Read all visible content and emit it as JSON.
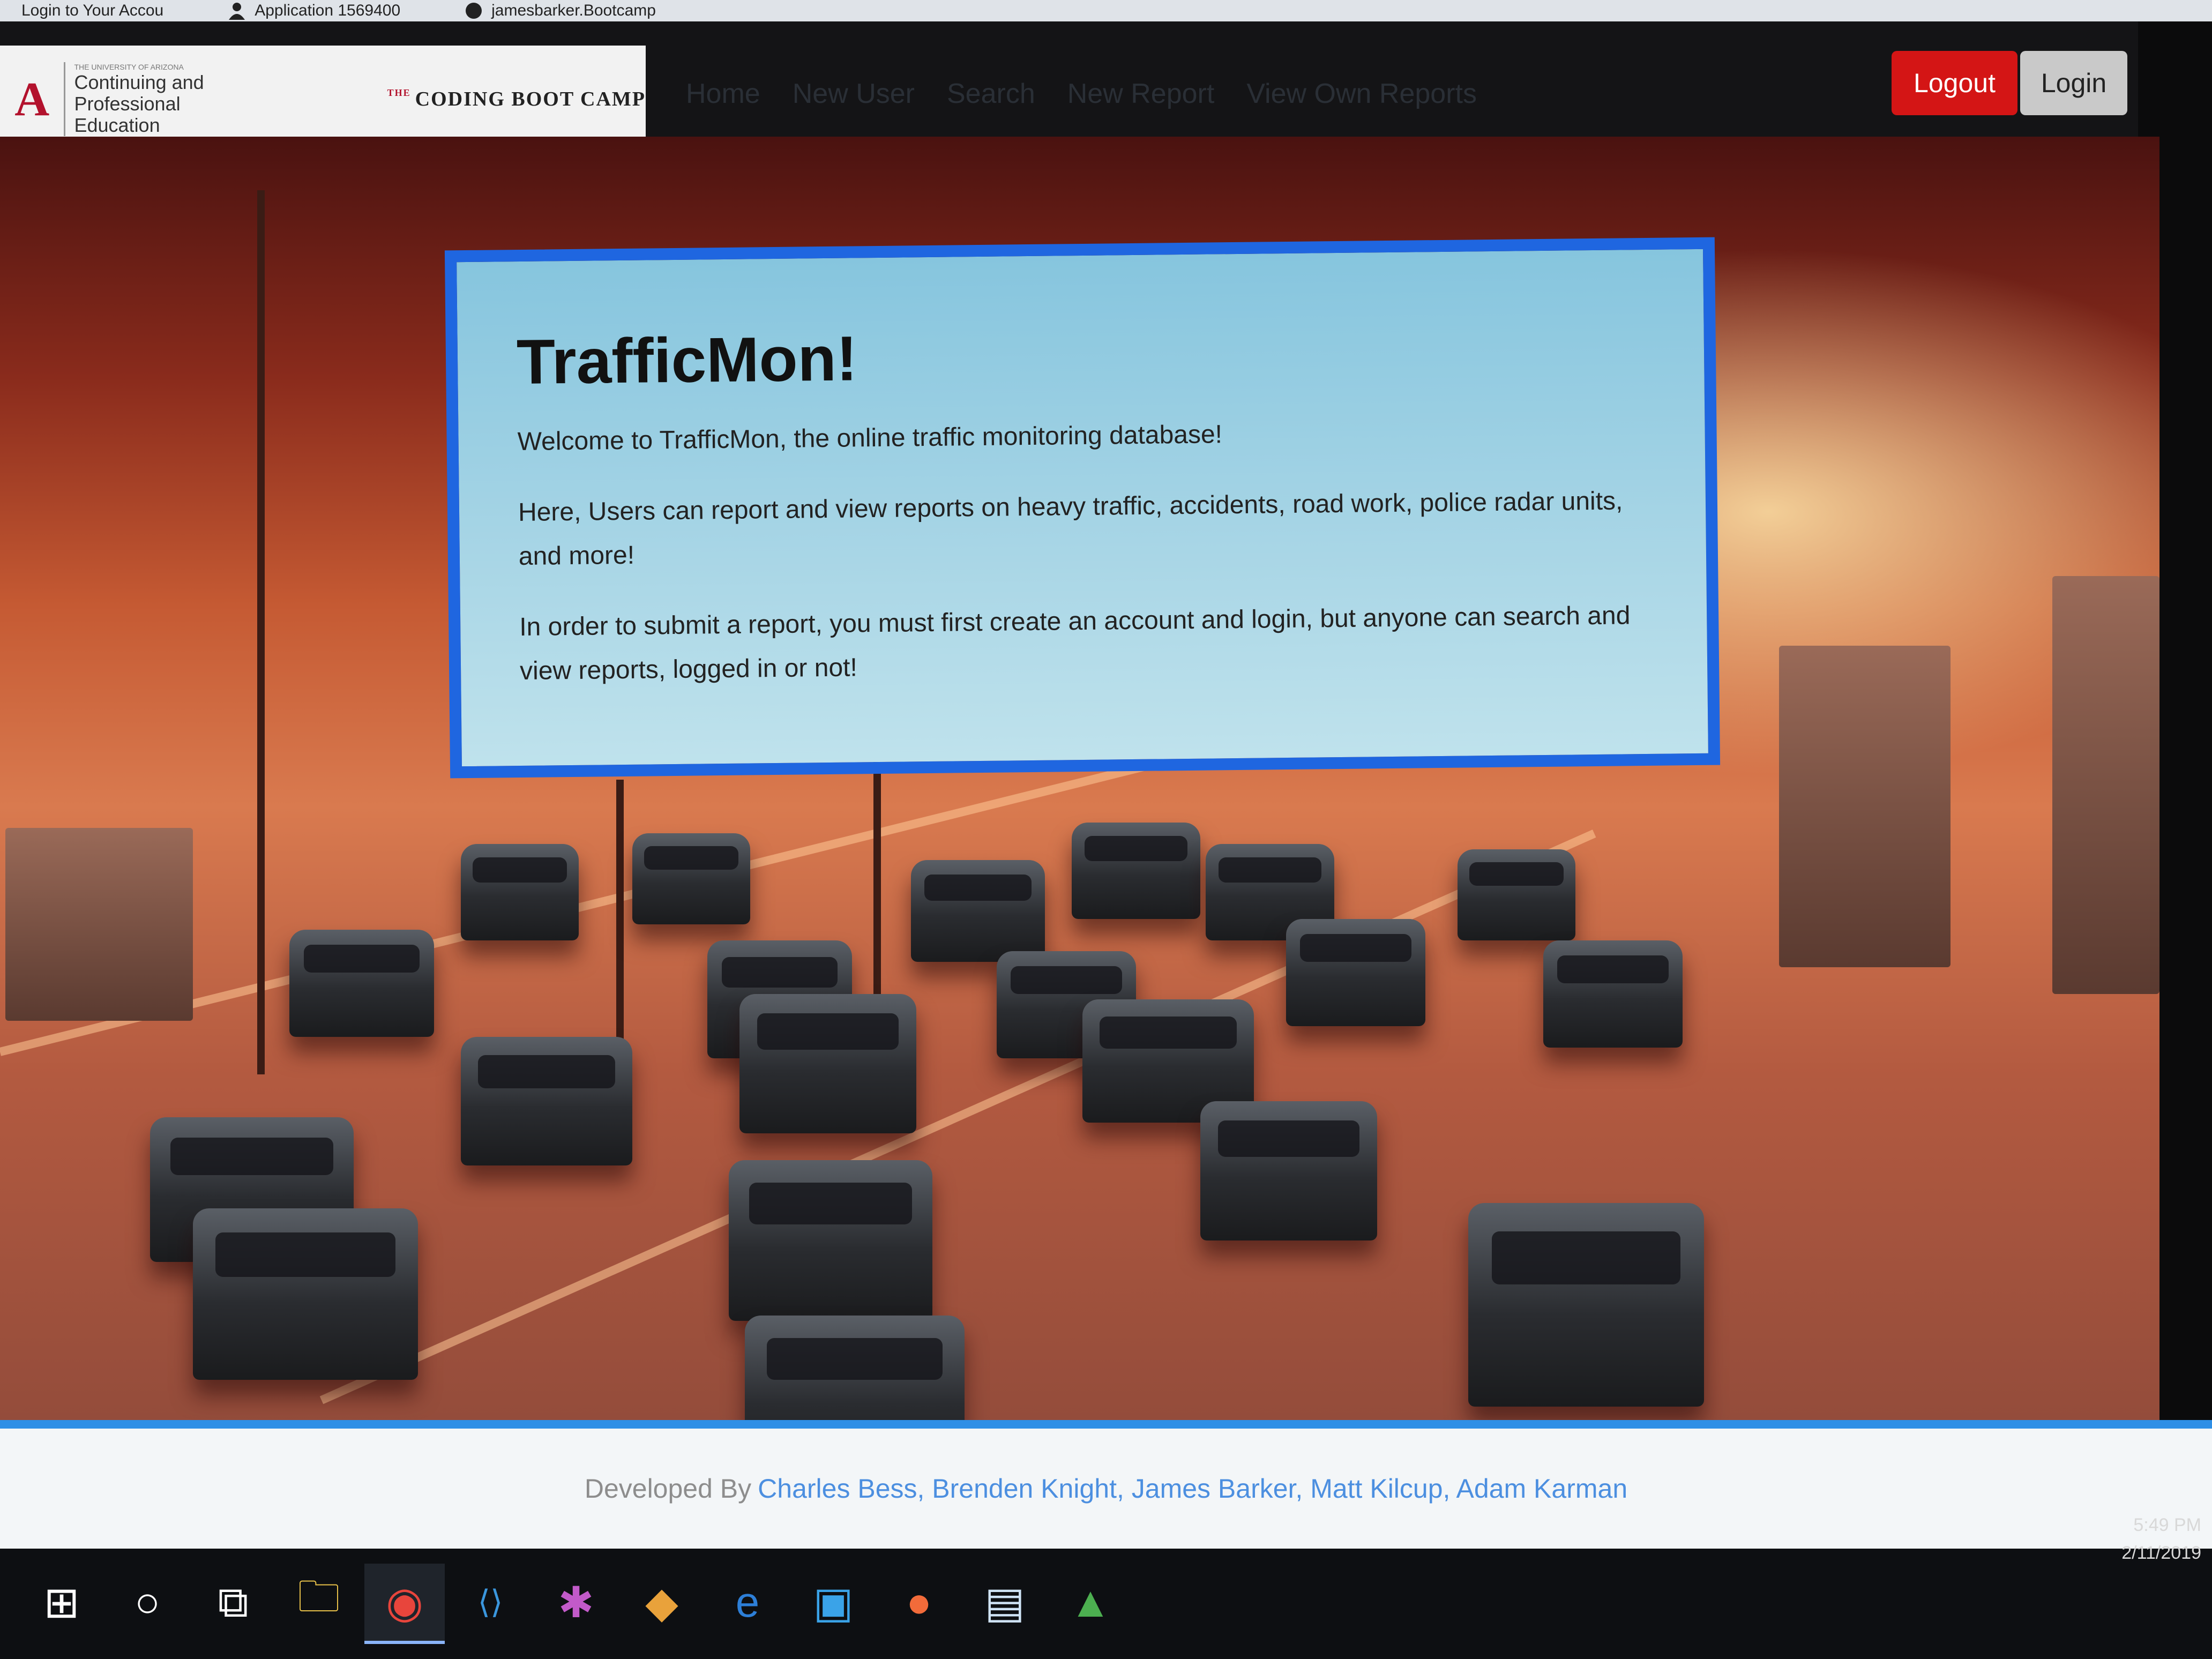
{
  "browser_tabs": [
    {
      "label": "Login to Your Accou"
    },
    {
      "label": "Application 1569400"
    },
    {
      "label": "jamesbarker.Bootcamp"
    }
  ],
  "navbar": {
    "brand": {
      "ua_mark": "A",
      "cpe_small": "THE UNIVERSITY OF ARIZONA",
      "cpe_line1": "Continuing and",
      "cpe_line2": "Professional Education",
      "bootcamp_the": "THE",
      "bootcamp": "CODING BOOT CAMP"
    },
    "links": [
      "Home",
      "New User",
      "Search",
      "New Report",
      "View Own Reports"
    ],
    "logout_label": "Logout",
    "login_label": "Login"
  },
  "jumbotron": {
    "title": "TrafficMon!",
    "welcome": "Welcome to TrafficMon, the online traffic monitoring database!",
    "description": "Here, Users can report and view reports on heavy traffic, accidents, road work, police radar units, and more!",
    "note": "In order to submit a report, you must first create an account and login, but anyone can search and view reports, logged in or not!"
  },
  "footer": {
    "prefix": "Developed By",
    "developers": "Charles Bess, Brenden Knight, James Barker, Matt Kilcup, Adam Karman"
  },
  "taskbar": {
    "items": [
      {
        "icon": "windows-start-icon",
        "glyph": "⊞"
      },
      {
        "icon": "cortana-icon",
        "glyph": "○"
      },
      {
        "icon": "task-view-icon",
        "glyph": "⧉"
      },
      {
        "icon": "file-explorer-icon",
        "glyph": "🗀"
      },
      {
        "icon": "chrome-icon",
        "glyph": "◉"
      },
      {
        "icon": "vscode-icon",
        "glyph": "⟨⟩"
      },
      {
        "icon": "slack-icon",
        "glyph": "✱"
      },
      {
        "icon": "sourcetree-icon",
        "glyph": "◆"
      },
      {
        "icon": "edge-icon",
        "glyph": "e"
      },
      {
        "icon": "app-icon",
        "glyph": "▣"
      },
      {
        "icon": "postman-icon",
        "glyph": "●"
      },
      {
        "icon": "notepad-icon",
        "glyph": "▤"
      },
      {
        "icon": "tree-app-icon",
        "glyph": "▲"
      }
    ],
    "time": "5:49 PM",
    "date": "2/11/2019"
  },
  "colors": {
    "logout": "#d41515",
    "login": "#c9c9c9",
    "jumbotron_border": "#1f66e0",
    "footer_accent": "#2f8fe6"
  }
}
